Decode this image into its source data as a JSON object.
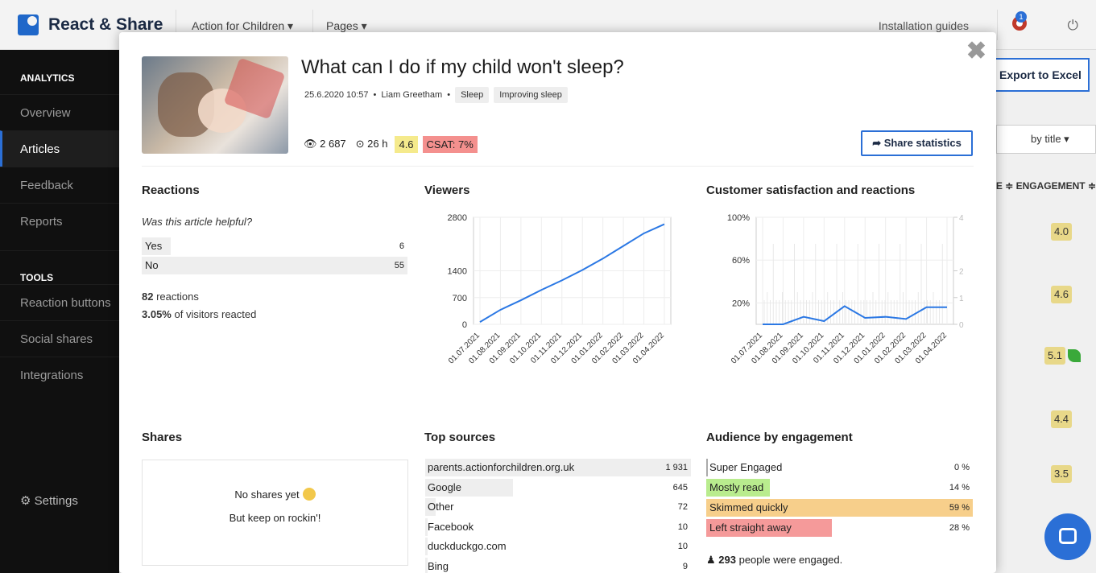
{
  "app": {
    "brand": "React & Share",
    "nav": [
      {
        "label": "Action for Children ▾"
      },
      {
        "label": "Pages ▾"
      }
    ],
    "install_label": "Installation guides",
    "notification_count": "1"
  },
  "sidebar": {
    "analytics_heading": "ANALYTICS",
    "analytics_items": [
      {
        "label": "Overview"
      },
      {
        "label": "Articles"
      },
      {
        "label": "Feedback"
      },
      {
        "label": "Reports"
      }
    ],
    "tools_heading": "TOOLS",
    "tools_items": [
      {
        "label": "Reaction buttons"
      },
      {
        "label": "Social shares"
      },
      {
        "label": "Integrations"
      }
    ],
    "settings_label": "⚙ Settings"
  },
  "background": {
    "export_label": "Export to Excel",
    "sort_label": "by title ▾",
    "column_header": "IE ≑  ENGAGEMENT ≑",
    "engagement_scores": [
      "4.0",
      "4.6",
      "5.1",
      "4.4",
      "3.5"
    ]
  },
  "article": {
    "title": "What can I do if my child won't sleep?",
    "date": "25.6.2020 10:57",
    "author": "Liam Greetham",
    "tags": [
      "Sleep",
      "Improving sleep"
    ],
    "views": "👁 2 687",
    "time": "⊙ 26 h",
    "score": "4.6",
    "csat": "CSAT: 7%",
    "share_label": "➦ Share statistics"
  },
  "reactions": {
    "title": "Reactions",
    "question": "Was this article helpful?",
    "rows": [
      {
        "label": "Yes",
        "value": "6",
        "pct": 0.1
      },
      {
        "label": "No",
        "value": "55",
        "pct": 1.0
      }
    ],
    "summary_count": "82",
    "summary_count_label": " reactions",
    "summary_pct": "3.05%",
    "summary_pct_label": " of visitors reacted"
  },
  "chart_data": [
    {
      "type": "line",
      "title": "Viewers",
      "x": [
        "01.07.2021",
        "01.08.2021",
        "01.09.2021",
        "01.10.2021",
        "01.11.2021",
        "01.12.2021",
        "01.01.2022",
        "01.02.2022",
        "01.03.2022",
        "01.04.2022"
      ],
      "series": [
        {
          "values": [
            60,
            380,
            630,
            900,
            1150,
            1420,
            1720,
            2050,
            2380,
            2620
          ]
        }
      ],
      "y_ticks": [
        "0",
        "700",
        "1400",
        "2800"
      ],
      "ylim": [
        0,
        2800
      ]
    },
    {
      "type": "line",
      "title": "Customer satisfaction and reactions",
      "x": [
        "01.07.2021",
        "01.08.2021",
        "01.09.2021",
        "01.10.2021",
        "01.11.2021",
        "01.12.2021",
        "01.01.2022",
        "01.02.2022",
        "01.03.2022",
        "01.04.2022"
      ],
      "series": [
        {
          "values": [
            0,
            0,
            7,
            3,
            17,
            6,
            7,
            5,
            16,
            16
          ]
        }
      ],
      "y_ticks_left": [
        "20%",
        "60%",
        "100%"
      ],
      "y_ticks_right": [
        "0",
        "1",
        "2",
        "4"
      ],
      "ylim": [
        0,
        100
      ]
    }
  ],
  "shares": {
    "title": "Shares",
    "line1": "No shares yet",
    "line2": "But keep on rockin'!"
  },
  "sources": {
    "title": "Top sources",
    "rows": [
      {
        "label": "parents.actionforchildren.org.uk",
        "value": "1 931",
        "pct": 1.0
      },
      {
        "label": "Google",
        "value": "645",
        "pct": 0.33
      },
      {
        "label": "Other",
        "value": "72",
        "pct": 0.04
      },
      {
        "label": "Facebook",
        "value": "10",
        "pct": 0.01
      },
      {
        "label": "duckduckgo.com",
        "value": "10",
        "pct": 0.01
      },
      {
        "label": "Bing",
        "value": "9",
        "pct": 0.01
      }
    ]
  },
  "audience": {
    "title": "Audience by engagement",
    "rows": [
      {
        "label": "Super Engaged",
        "value": "0 %",
        "pct": 0.0,
        "color": "#9adf7e"
      },
      {
        "label": "Mostly read",
        "value": "14 %",
        "pct": 0.24,
        "color": "#b9ec8e"
      },
      {
        "label": "Skimmed quickly",
        "value": "59 %",
        "pct": 1.0,
        "color": "#f7cf8b"
      },
      {
        "label": "Left straight away",
        "value": "28 %",
        "pct": 0.47,
        "color": "#f59a9a"
      }
    ],
    "engaged_count": "293",
    "engaged_label": " people were engaged."
  }
}
